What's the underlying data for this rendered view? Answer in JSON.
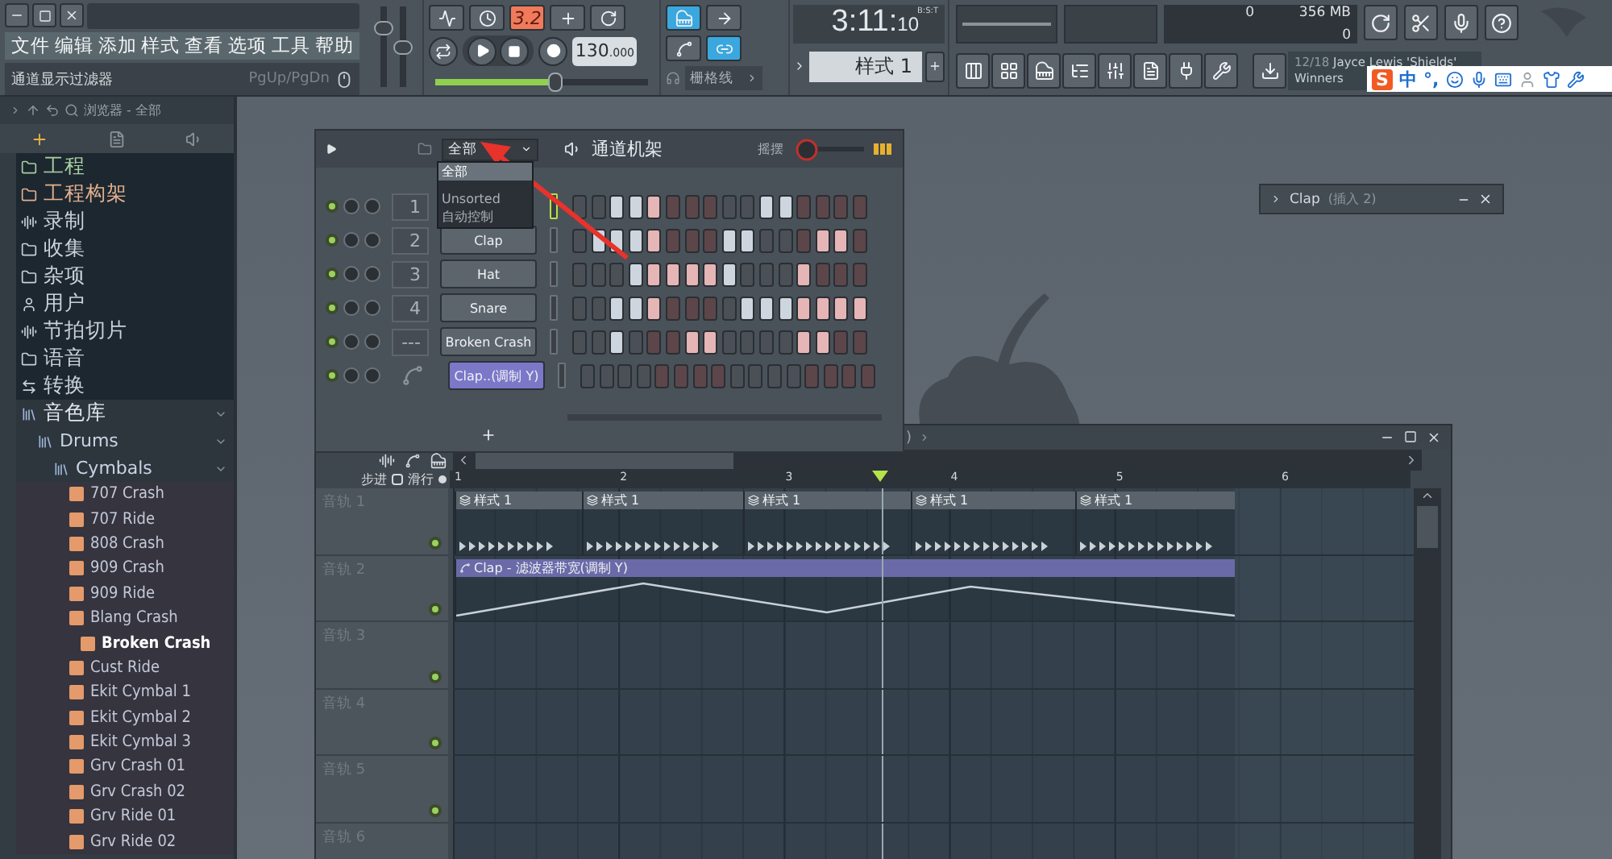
{
  "menu": [
    "文件",
    "编辑",
    "添加",
    "样式",
    "查看",
    "选项",
    "工具",
    "帮助"
  ],
  "hint_bar": {
    "text": "通道显示过滤器",
    "shortcut": "PgUp/PgDn"
  },
  "master": {
    "volume": {
      "level": 0.78
    },
    "pitch": {
      "level": 0.5
    }
  },
  "transport": {
    "countdown": "3.2",
    "tempo": "130",
    "tempo_fraction": ".000",
    "volume": {
      "level": 0.56
    }
  },
  "snap": {
    "label": "栅格线"
  },
  "time": {
    "main": "3:11:",
    "ticks": "10",
    "unit": "B:S:T"
  },
  "pattern": {
    "label": "样式 1"
  },
  "status": {
    "cpu": "0",
    "memory": "356 MB",
    "polyphony": "0"
  },
  "song": {
    "position": "12/18",
    "title": "Jayce Lewis 'Shields'",
    "subtitle": "Winners"
  },
  "ime": {
    "logo": "S",
    "mode": "中",
    "punct": "°,"
  },
  "browser": {
    "path": "浏览器 - 全部",
    "items": [
      {
        "label": "工程",
        "kind": "folder",
        "color": "#a8d0a0"
      },
      {
        "label": "工程构架",
        "kind": "folder",
        "color": "#e2b08e"
      },
      {
        "label": "录制",
        "kind": "audio",
        "color": "#c9d1d9"
      },
      {
        "label": "收集",
        "kind": "folder",
        "color": "#c9d1d9"
      },
      {
        "label": "杂项",
        "kind": "folder",
        "color": "#c9d1d9"
      },
      {
        "label": "用户",
        "kind": "user",
        "color": "#c9d1d9"
      },
      {
        "label": "节拍切片",
        "kind": "audio",
        "color": "#c9d1d9"
      },
      {
        "label": "语音",
        "kind": "folder",
        "color": "#c9d1d9"
      },
      {
        "label": "转换",
        "kind": "convert",
        "color": "#c9d1d9"
      },
      {
        "label": "音色库",
        "kind": "library",
        "color": "#dfe6ee",
        "expanded": true,
        "children": [
          {
            "label": "Drums",
            "kind": "library",
            "expanded": true,
            "children": [
              {
                "label": "Cymbals",
                "kind": "library",
                "expanded": true,
                "children": [
                  {
                    "label": "707 Crash",
                    "kind": "sample",
                    "selected": false
                  },
                  {
                    "label": "707 Ride",
                    "kind": "sample",
                    "selected": false
                  },
                  {
                    "label": "808 Crash",
                    "kind": "sample",
                    "selected": false
                  },
                  {
                    "label": "909 Crash",
                    "kind": "sample",
                    "selected": false
                  },
                  {
                    "label": "909 Ride",
                    "kind": "sample",
                    "selected": false
                  },
                  {
                    "label": "Blang Crash",
                    "kind": "sample",
                    "selected": false
                  },
                  {
                    "label": "Broken Crash",
                    "kind": "sample",
                    "selected": true
                  },
                  {
                    "label": "Cust Ride",
                    "kind": "sample",
                    "selected": false
                  },
                  {
                    "label": "Ekit Cymbal 1",
                    "kind": "sample",
                    "selected": false
                  },
                  {
                    "label": "Ekit Cymbal 2",
                    "kind": "sample",
                    "selected": false
                  },
                  {
                    "label": "Ekit Cymbal 3",
                    "kind": "sample",
                    "selected": false
                  },
                  {
                    "label": "Grv Crash 01",
                    "kind": "sample",
                    "selected": false
                  },
                  {
                    "label": "Grv Crash 02",
                    "kind": "sample",
                    "selected": false
                  },
                  {
                    "label": "Grv Ride 01",
                    "kind": "sample",
                    "selected": false
                  },
                  {
                    "label": "Grv Ride 02",
                    "kind": "sample",
                    "selected": false
                  }
                ]
              }
            ]
          }
        ]
      }
    ]
  },
  "channel_rack": {
    "filter": "全部",
    "title": "通道机架",
    "swing_label": "摇摆",
    "swing": {
      "level": 0.05
    },
    "filter_menu": [
      {
        "label": "全部",
        "selected": true
      },
      {
        "label": "Unsorted",
        "selected": false
      },
      {
        "label": "自动控制",
        "selected": false
      }
    ],
    "channels": [
      {
        "kind": "sampler",
        "number": "1",
        "selected": true,
        "steps": [
          false,
          false,
          true,
          true,
          true,
          false,
          false,
          false,
          false,
          false,
          true,
          true,
          false,
          false,
          false,
          false
        ]
      },
      {
        "kind": "sampler",
        "number": "2",
        "name": "Clap",
        "selected": false,
        "steps": [
          false,
          true,
          true,
          true,
          true,
          false,
          false,
          false,
          true,
          true,
          false,
          false,
          false,
          true,
          true,
          false
        ]
      },
      {
        "kind": "sampler",
        "number": "3",
        "name": "Hat",
        "selected": false,
        "steps": [
          false,
          false,
          false,
          true,
          true,
          true,
          true,
          true,
          true,
          false,
          false,
          false,
          true,
          false,
          false,
          false
        ]
      },
      {
        "kind": "sampler",
        "number": "4",
        "name": "Snare",
        "selected": false,
        "steps": [
          false,
          false,
          true,
          true,
          true,
          false,
          false,
          false,
          false,
          true,
          true,
          true,
          true,
          true,
          true,
          true
        ]
      },
      {
        "kind": "sampler",
        "number": "---",
        "name": "Broken Crash",
        "selected": false,
        "steps": [
          false,
          false,
          true,
          false,
          false,
          false,
          true,
          true,
          false,
          false,
          false,
          false,
          true,
          true,
          false,
          false
        ]
      },
      {
        "kind": "automation",
        "name": "Clap..(调制 Y)",
        "selected": false,
        "steps": [
          false,
          false,
          false,
          false,
          false,
          false,
          false,
          false,
          false,
          false,
          false,
          false,
          false,
          false,
          false,
          false
        ]
      }
    ]
  },
  "mixer_window": {
    "name": "Clap",
    "detail": "(插入 2)"
  },
  "playlist": {
    "title": ")",
    "step_label": "步进",
    "step_checked": false,
    "slide_label": "滑行",
    "ruler": [
      "1",
      "2",
      "3",
      "4",
      "5",
      "6"
    ],
    "tracks": [
      {
        "name": "音轨 1",
        "clips": [
          {
            "kind": "pattern",
            "label": "样式 1"
          },
          {
            "kind": "pattern",
            "label": "样式 1"
          },
          {
            "kind": "pattern",
            "label": "样式 1"
          },
          {
            "kind": "pattern",
            "label": "样式 1"
          },
          {
            "kind": "pattern",
            "label": "样式 1"
          }
        ]
      },
      {
        "name": "音轨 2",
        "clips": [
          {
            "kind": "automation",
            "label": "Clap - 滤波器带宽(调制 Y)"
          }
        ]
      },
      {
        "name": "音轨 3"
      },
      {
        "name": "音轨 4"
      },
      {
        "name": "音轨 5"
      },
      {
        "name": "音轨 6"
      }
    ]
  }
}
